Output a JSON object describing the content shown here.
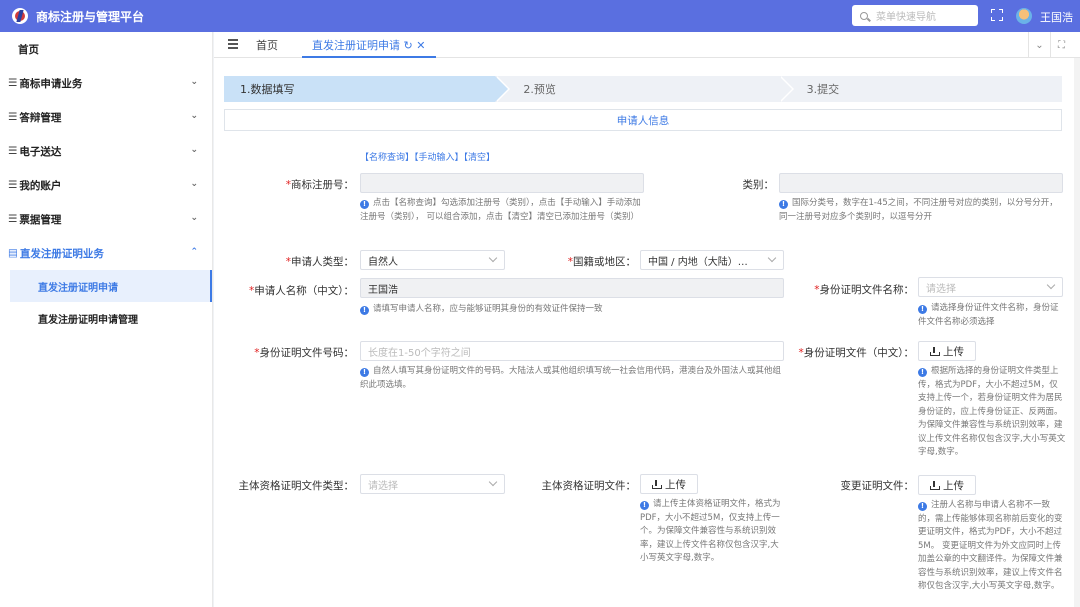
{
  "app": {
    "title": "商标注册与管理平台",
    "search_placeholder": "菜单快速导航",
    "user": "王国浩"
  },
  "sidebar": {
    "home": "首页",
    "groups": [
      {
        "label": "商标申请业务"
      },
      {
        "label": "答辩管理"
      },
      {
        "label": "电子送达"
      },
      {
        "label": "我的账户"
      },
      {
        "label": "票据管理"
      },
      {
        "label": "直发注册证明业务"
      }
    ],
    "sub_items": [
      {
        "label": "直发注册证明申请"
      },
      {
        "label": "直发注册证明申请管理"
      }
    ]
  },
  "tabs": {
    "home": "首页",
    "current": "直发注册证明申请"
  },
  "steps": [
    {
      "label": "1.数据填写"
    },
    {
      "label": "2.预览"
    },
    {
      "label": "3.提交"
    }
  ],
  "section_title": "申请人信息",
  "links": "【名称查询】【手动输入】【清空】",
  "form": {
    "reg_no": {
      "label": "商标注册号：",
      "hint": "点击【名称查询】勾选添加注册号（类别），点击【手动输入】手动添加注册号（类别）， 可以组合添加，点击【清空】清空已添加注册号（类别）"
    },
    "category": {
      "label": "类别：",
      "hint": "国际分类号，数字在1-45之间，不同注册号对应的类别，以分号分开，同一注册号对应多个类别时，以逗号分开"
    },
    "applicant_type": {
      "label": "申请人类型：",
      "value": "自然人"
    },
    "nationality": {
      "label": "国籍或地区：",
      "value": "中国 / 内地（大陆）…"
    },
    "applicant_name": {
      "label": "申请人名称（中文）：",
      "value": "王国浩",
      "hint": "请填写申请人名称，应与能够证明其身份的有效证件保持一致"
    },
    "id_doc_name": {
      "label": "身份证明文件名称：",
      "placeholder": "请选择",
      "hint": "请选择身份证件文件名称，身份证件文件名称必须选择"
    },
    "id_doc_no": {
      "label": "身份证明文件号码：",
      "placeholder": "长度在1-50个字符之间",
      "hint": "自然人填写其身份证明文件的号码。大陆法人或其他组织填写统一社会信用代码，港澳台及外国法人或其他组织此项选填。"
    },
    "id_doc_file": {
      "label": "身份证明文件（中文）：",
      "button": "上传",
      "hint": "根据所选择的身份证明文件类型上传，格式为PDF，大小不超过5M，仅支持上传一个，若身份证明文件为居民身份证的，应上传身份证正、反两面。为保障文件兼容性与系统识别效率，建议上传文件名称仅包含汉字,大小写英文字母,数字。"
    },
    "qual_type": {
      "label": "主体资格证明文件类型：",
      "placeholder": "请选择"
    },
    "qual_file": {
      "label": "主体资格证明文件：",
      "button": "上传",
      "hint": "请上传主体资格证明文件，格式为PDF，大小不超过5M，仅支持上传一个。为保障文件兼容性与系统识别效率，建议上传文件名称仅包含汉字,大小写英文字母,数字。"
    },
    "change_file": {
      "label": "变更证明文件：",
      "button": "上传",
      "hint": "注册人名称与申请人名称不一致的，需上传能够体现名称前后变化的变更证明文件，格式为PDF，大小不超过5M。 变更证明文件为外文应同时上传加盖公章的中文翻译件。为保障文件兼容性与系统识别效率，建议上传文件名称仅包含汉字,大小写英文字母,数字。"
    }
  }
}
